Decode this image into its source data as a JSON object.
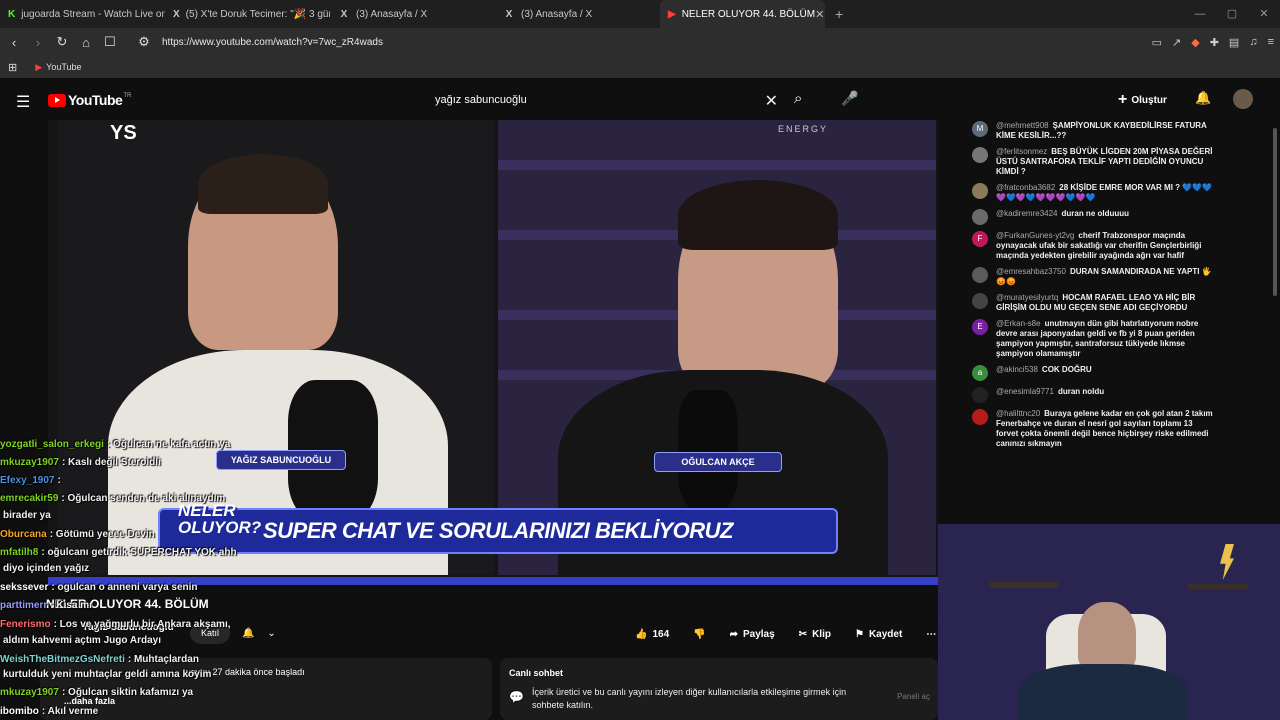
{
  "browser": {
    "tabs": [
      {
        "label": "jugoarda Stream - Watch Live on Kick",
        "icon": "K"
      },
      {
        "label": "(5) X'te Doruk Tecimer: \"🎉 3 gün önce",
        "icon": "X"
      },
      {
        "label": "(3) Anasayfa / X",
        "icon": "X"
      },
      {
        "label": "(3) Anasayfa / X",
        "icon": "X"
      },
      {
        "label": "NELER OLUYOR 44. BÖLÜM",
        "icon": "▶"
      }
    ],
    "url": "https://www.youtube.com/watch?v=7wc_zR4wads",
    "bookmark": "YouTube"
  },
  "yt": {
    "logo_text": "YouTube",
    "country": "TR",
    "search_value": "yağız sabuncuoğlu",
    "create_label": "Oluştur"
  },
  "video": {
    "brand": "ENERGY",
    "corner_mark": "YS",
    "name_left": "YAĞIZ SABUNCUOĞLU",
    "name_right": "OĞULCAN AKÇE",
    "banner": "SUPER CHAT VE SORULARINIZI BEKLİYORUZ",
    "show_logo_1": "NELER",
    "show_logo_2": "OLUYOR?"
  },
  "details": {
    "title": "NELER OLUYOR 44. BÖLÜM",
    "channel": "Yağız Sabuncuoğlu",
    "join_label": "Katıl",
    "likes": "164",
    "share_label": "Paylaş",
    "clip_label": "Klip",
    "save_label": "Kaydet",
    "live_info": "yayını 27 dakika önce başladı",
    "more_label": "...daha fazla"
  },
  "chat_info": {
    "title": "Canlı sohbet",
    "desc": "İçerik üretici ve bu canlı yayını izleyen diğer kullanıcılarla etkileşime girmek için sohbete katılın.",
    "button": "Paneli aç"
  },
  "chat": [
    {
      "author": "@mehmett908",
      "text": "ŞAMPİYONLUK KAYBEDİLİRSE FATURA KİME KESİLİR...??",
      "avatar": "M",
      "color": "#5b6b7a"
    },
    {
      "author": "@ferlitsonmez",
      "text": "BEŞ BÜYÜK LİGDEN 20M PİYASA DEĞERİ ÜSTÜ SANTRAFORA TEKLİF YAPTI DEDİĞİN OYUNCU KİMDİ ?",
      "avatar": "",
      "color": "#777777"
    },
    {
      "author": "@fratconba3682",
      "text": "28 KİŞİDE EMRE MOR VAR MI ? 💙💙💙💜💙💜💙💜💜💜💙💜💙",
      "avatar": "",
      "color": "#8a7a5a"
    },
    {
      "author": "@kadiremre3424",
      "text": "duran ne olduuuu",
      "avatar": "",
      "color": "#6a6a6a"
    },
    {
      "author": "@FurkanGunes-yt2vg",
      "text": "cherif Trabzonspor maçında oynayacak ufak bir sakatlığı var cherifin Gençlerbirliği maçında yedekten girebilir ayağında ağrı var hafif",
      "avatar": "F",
      "color": "#c2185b"
    },
    {
      "author": "@emresahbaz3750",
      "text": "DURAN SAMANDIRADA NE YAPTI 🖐😡😡",
      "avatar": "",
      "color": "#5a5a5a"
    },
    {
      "author": "@muratyesilyurtq",
      "text": "HOCAM RAFAEL LEAO YA HİÇ BİR GİRİŞİM OLDU MU GEÇEN SENE ADI GEÇİYORDU",
      "avatar": "",
      "color": "#444444"
    },
    {
      "author": "@Erkan-s8e",
      "text": "unutmayın dün gibi hatırlatıyorum nobre devre arası japonyadan geldi ve fb yi 8 puan geriden şampiyon yapmıştır, santraforsuz tükiyede lıkmse şampiyon olamamıştır",
      "avatar": "E",
      "color": "#7b1fa2"
    },
    {
      "author": "@akinci538",
      "text": "COK DOĞRU",
      "avatar": "a",
      "color": "#388e3c"
    },
    {
      "author": "@enesimla9771",
      "text": "duran noldu",
      "avatar": "",
      "color": "#222222"
    },
    {
      "author": "@halilttnc20",
      "text": "Buraya gelene kadar en çok gol atan 2 takım Fenerbahçe ve duran el nesri gol sayıları toplamı 13 forvet çokta önemli değil bence hiçbirşey riske edilmedi canınızı sıkmayın",
      "avatar": "",
      "color": "#b71c1c"
    }
  ],
  "overlay_chat": [
    {
      "name": "yozgatli_salon_erkegi",
      "text": ": Oğulcan ne kafa actın ya",
      "color": "#7ed321"
    },
    {
      "name": "mkuzay1907",
      "text": ": Kaslı değil Steroidli",
      "color": "#7ed321"
    },
    {
      "name": "Efexy_1907",
      "text": ":",
      "color": "#4a90e2"
    },
    {
      "name": "emrecakir59",
      "text": ": Oğulcan senden de aki alınaydım",
      "color": "#7ed321"
    },
    {
      "name": "",
      "text": "birader ya",
      "color": "#ffffff"
    },
    {
      "name": "Oburcana",
      "text": ": Götümü yeeee Devin",
      "color": "#f5a623"
    },
    {
      "name": "mfatilh8",
      "text": ": oğulcanı getirdik SUPERCHAT YOK ahh",
      "color": "#7ed321"
    },
    {
      "name": "",
      "text": "diyo içinden yağız",
      "color": "#ffffff"
    },
    {
      "name": "sekssever",
      "text": ": ogulcan o anneni varya senin",
      "color": "#ffffff"
    },
    {
      "name": "parttimerr",
      "text": ": Kısa mı",
      "color": "#9b9bff"
    },
    {
      "name": "Fenerismo",
      "text": ": Los ve yağmurlu bir Ankara akşamı,",
      "color": "#ff6b6b"
    },
    {
      "name": "",
      "text": "aldım kahvemi açtım Jugo Ardayı",
      "color": "#ffffff"
    },
    {
      "name": "WeishTheBitmezGsNefreti",
      "text": ": Muhtaçlardan",
      "color": "#7ed3d3"
    },
    {
      "name": "",
      "text": "kurtulduk yeni muhtaçlar geldi amına koyim",
      "color": "#ffffff"
    },
    {
      "name": "mkuzay1907",
      "text": ": Oğulcan siktin kafamızı ya",
      "color": "#7ed321"
    },
    {
      "name": "ibomibo",
      "text": ": Akıl verme",
      "color": "#ffffff"
    }
  ]
}
